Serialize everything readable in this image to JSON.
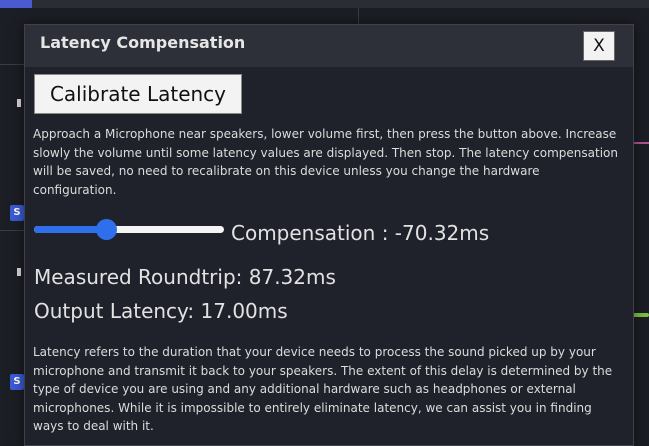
{
  "dialog": {
    "title": "Latency Compensation",
    "close_label": "X",
    "calibrate_label": "Calibrate Latency",
    "instructions": "Approach a Microphone near speakers, lower volume first, then press the button above. Increase slowly the volume until some latency values are displayed. Then stop. The latency compensation will be saved, no need to recalibrate on this device unless you change the hardware configuration.",
    "slider": {
      "value_fraction": 0.38
    },
    "compensation_text": "Compensation : -70.32ms",
    "roundtrip_text": "Measured Roundtrip: 87.32ms",
    "output_latency_text": "Output Latency: 17.00ms",
    "description": "Latency refers to the duration that your device needs to process the sound picked up by your microphone and transmit it back to your speakers. The extent of this delay is determined by the type of device you are using and any additional hardware such as headphones or external microphones. While it is impossible to entirely eliminate latency, we can assist you in finding ways to deal with it."
  },
  "background": {
    "badge_letter": "S"
  },
  "colors": {
    "accent": "#2f6fec",
    "dialog_bg": "#20222b",
    "header_bg": "#2d3039"
  }
}
